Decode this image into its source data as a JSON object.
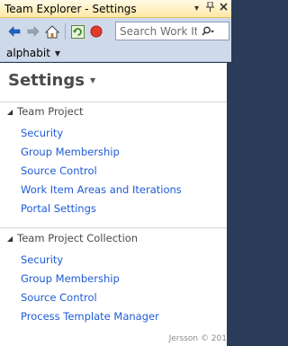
{
  "window": {
    "title": "Team Explorer - Settings",
    "pin_glyph": "↓",
    "autohide_glyph": "❘",
    "close_glyph": "✕"
  },
  "toolbar": {
    "back_icon": "back-arrow-icon",
    "forward_icon": "forward-arrow-icon",
    "home_icon": "home-icon",
    "refresh_icon": "refresh-icon",
    "stop_icon": "stop-icon",
    "search_placeholder": "Search Work Iten",
    "search_icon": "search-icon"
  },
  "context": {
    "project": "alphabit"
  },
  "page": {
    "title": "Settings"
  },
  "sections": [
    {
      "header": "Team Project",
      "links": [
        "Security",
        "Group Membership",
        "Source Control",
        "Work Item Areas and Iterations",
        "Portal Settings"
      ]
    },
    {
      "header": "Team Project Collection",
      "links": [
        "Security",
        "Group Membership",
        "Source Control",
        "Process Template Manager"
      ]
    }
  ],
  "watermark": "Jersson © 201",
  "colors": {
    "titlebar": "#ffe8a6",
    "toolbar": "#ced9ea",
    "frame": "#2b3c59",
    "link": "#1e5bd6"
  }
}
